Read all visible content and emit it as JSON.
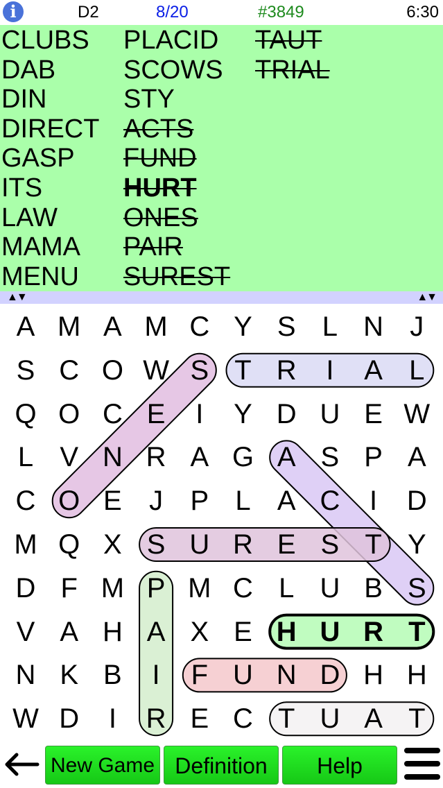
{
  "status": {
    "info_icon": "info-icon",
    "level": "D2",
    "progress": "8/20",
    "game_number": "#3849",
    "time": "6:30"
  },
  "word_list": {
    "columns": [
      [
        {
          "word": "CLUBS",
          "found": false
        },
        {
          "word": "DAB",
          "found": false
        },
        {
          "word": "DIN",
          "found": false
        },
        {
          "word": "DIRECT",
          "found": false
        },
        {
          "word": "GASP",
          "found": false
        },
        {
          "word": "ITS",
          "found": false
        },
        {
          "word": "LAW",
          "found": false
        },
        {
          "word": "MAMA",
          "found": false
        },
        {
          "word": "MENU",
          "found": false
        }
      ],
      [
        {
          "word": "PLACID",
          "found": false
        },
        {
          "word": "SCOWS",
          "found": false
        },
        {
          "word": "STY",
          "found": false
        },
        {
          "word": "ACTS",
          "found": true
        },
        {
          "word": "FUND",
          "found": true
        },
        {
          "word": "HURT",
          "found": true,
          "bold": true
        },
        {
          "word": "ONES",
          "found": true
        },
        {
          "word": "PAIR",
          "found": true
        },
        {
          "word": "SUREST",
          "found": true
        }
      ],
      [
        {
          "word": "TAUT",
          "found": true
        },
        {
          "word": "TRIAL",
          "found": true
        }
      ]
    ],
    "scroll_arrows": "▲▼"
  },
  "grid": {
    "rows": [
      [
        "A",
        "M",
        "A",
        "M",
        "C",
        "Y",
        "S",
        "L",
        "N",
        "J"
      ],
      [
        "S",
        "C",
        "O",
        "W",
        "S",
        "T",
        "R",
        "I",
        "A",
        "L"
      ],
      [
        "Q",
        "O",
        "C",
        "E",
        "I",
        "Y",
        "D",
        "U",
        "E",
        "W"
      ],
      [
        "L",
        "V",
        "N",
        "R",
        "A",
        "G",
        "A",
        "S",
        "P",
        "A"
      ],
      [
        "C",
        "O",
        "E",
        "J",
        "P",
        "L",
        "A",
        "C",
        "I",
        "D"
      ],
      [
        "M",
        "Q",
        "X",
        "S",
        "U",
        "R",
        "E",
        "S",
        "T",
        "Y"
      ],
      [
        "D",
        "F",
        "M",
        "P",
        "M",
        "C",
        "L",
        "U",
        "B",
        "S"
      ],
      [
        "V",
        "A",
        "H",
        "A",
        "X",
        "E",
        "H",
        "U",
        "R",
        "T"
      ],
      [
        "N",
        "K",
        "B",
        "I",
        "F",
        "U",
        "N",
        "D",
        "H",
        "H"
      ],
      [
        "W",
        "D",
        "I",
        "R",
        "E",
        "C",
        "T",
        "U",
        "A",
        "T"
      ]
    ],
    "highlights": [
      {
        "word": "ONES",
        "start": [
          4,
          1
        ],
        "end": [
          1,
          4
        ],
        "color": "#e2bde0"
      },
      {
        "word": "TRIAL",
        "start": [
          1,
          5
        ],
        "end": [
          1,
          9
        ],
        "color": "#dadaf5"
      },
      {
        "word": "ACTS",
        "start": [
          3,
          6
        ],
        "end": [
          6,
          9
        ],
        "color": "#d9c8f5"
      },
      {
        "word": "SUREST",
        "start": [
          5,
          3
        ],
        "end": [
          5,
          8
        ],
        "color": "#dfc3dc"
      },
      {
        "word": "PAIR",
        "start": [
          6,
          3
        ],
        "end": [
          9,
          3
        ],
        "color": "#d3edcc"
      },
      {
        "word": "HURT",
        "start": [
          7,
          6
        ],
        "end": [
          7,
          9
        ],
        "color": "#b5fcb5",
        "selected": true
      },
      {
        "word": "FUND",
        "start": [
          8,
          4
        ],
        "end": [
          8,
          7
        ],
        "color": "#f4c8cb"
      },
      {
        "word": "TAUT",
        "start": [
          9,
          6
        ],
        "end": [
          9,
          9
        ],
        "color": "#f3f1f2"
      }
    ],
    "bold_cells": [
      [
        7,
        6
      ],
      [
        7,
        7
      ],
      [
        7,
        8
      ],
      [
        7,
        9
      ]
    ]
  },
  "toolbar": {
    "back_icon": "arrow-left-icon",
    "new_game_label": "New Game",
    "definition_label": "Definition",
    "help_label": "Help",
    "menu_icon": "hamburger-menu-icon",
    "button_color": "#22e622"
  }
}
